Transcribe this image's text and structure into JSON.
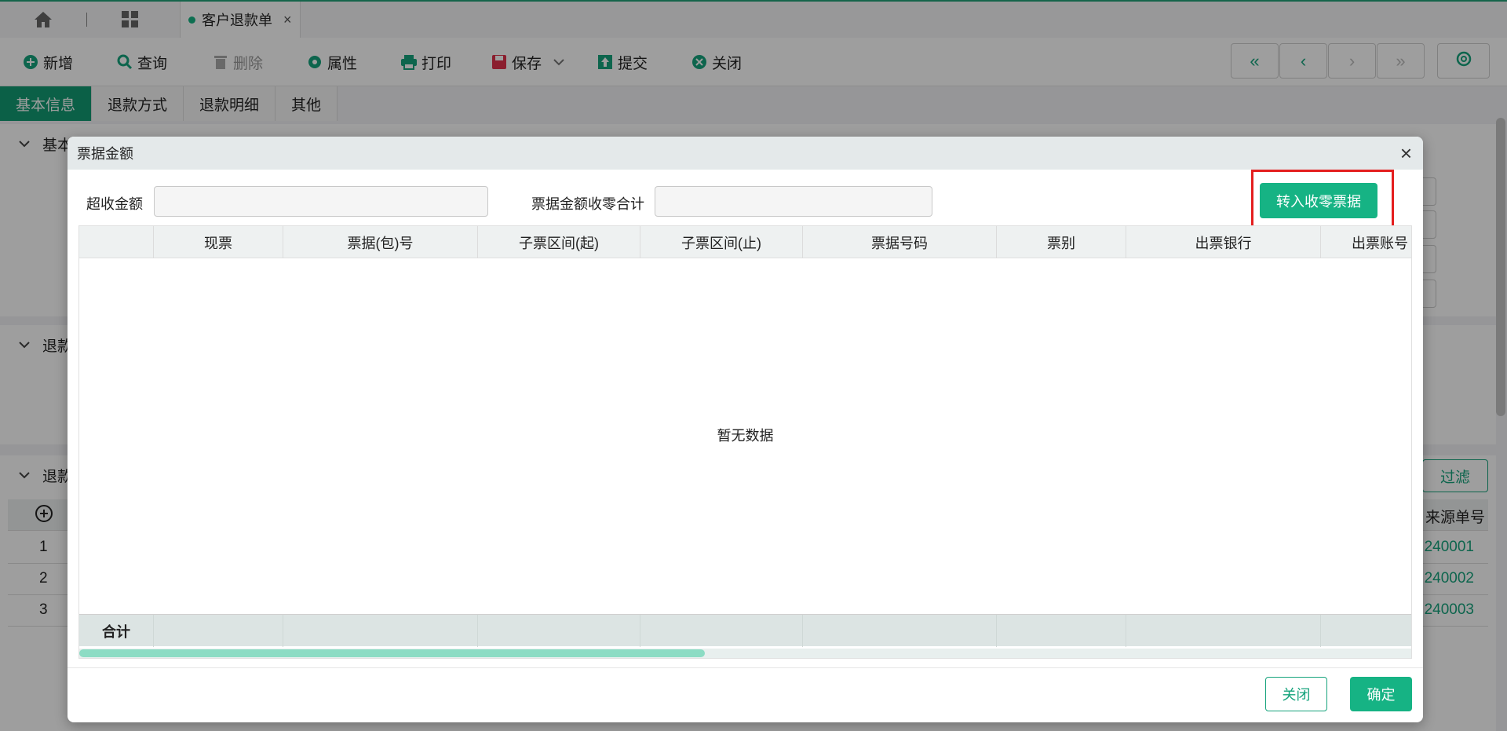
{
  "topbar": {
    "home_icon": "home-icon",
    "apps_icon": "grid-icon",
    "active_tab": {
      "label": "客户退款单",
      "close": "×"
    }
  },
  "toolbar": {
    "add": "新增",
    "query": "查询",
    "delete": "删除",
    "properties": "属性",
    "print": "打印",
    "save": "保存",
    "submit": "提交",
    "close": "关闭",
    "nav_first": "«",
    "nav_prev": "‹",
    "nav_next": "›",
    "nav_last": "»"
  },
  "section_tabs": [
    "基本信息",
    "退款方式",
    "退款明细",
    "其他"
  ],
  "background": {
    "section1": "基本",
    "section2": "退款",
    "section3": "退款",
    "filter": "过滤",
    "source_col": "来源单号",
    "rows": [
      {
        "num": "1",
        "code": "240001"
      },
      {
        "num": "2",
        "code": "240002"
      },
      {
        "num": "3",
        "code": "240003"
      }
    ]
  },
  "dialog": {
    "title": "票据金额",
    "close_icon": "×",
    "over_amount_label": "超收金额",
    "over_amount_value": "",
    "zero_total_label": "票据金额收零合计",
    "zero_total_value": "",
    "convert_button": "转入收零票据",
    "columns": [
      "现票",
      "票据(包)号",
      "子票区间(起)",
      "子票区间(止)",
      "票据号码",
      "票别",
      "出票银行",
      "出票账号"
    ],
    "empty_text": "暂无数据",
    "footer_total": "合计",
    "close_button": "关闭",
    "confirm_button": "确定"
  },
  "colors": {
    "accent": "#16b384",
    "highlight": "#e41e1e"
  }
}
